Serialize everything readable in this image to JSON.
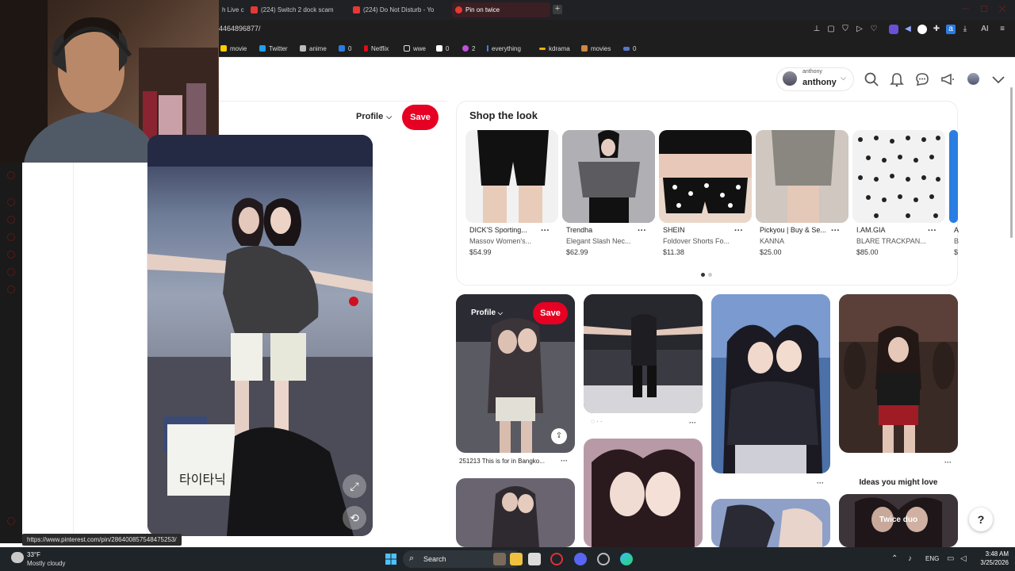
{
  "browser": {
    "tabs": [
      {
        "label": "h Live c"
      },
      {
        "label": "(224) Switch 2 dock scam"
      },
      {
        "label": "(224) Do Not Disturb - Yo"
      },
      {
        "label": "Pin on twice"
      }
    ],
    "new_tab": "+",
    "url": "4464896877/",
    "bookmarks": [
      {
        "label": "movie",
        "color": "#ffcc00"
      },
      {
        "label": "Twitter",
        "color": "#1da1f2"
      },
      {
        "label": "anime",
        "color": "#bbbbbb"
      },
      {
        "label": "0",
        "color": "#2a7de1"
      },
      {
        "label": "Netflix",
        "color": "#e50914"
      },
      {
        "label": "wwe",
        "color": "#dddddd"
      },
      {
        "label": "0",
        "color": "#ffffff"
      },
      {
        "label": "2",
        "color": "#c050e0"
      },
      {
        "label": "everything",
        "color": "#3b82f6"
      },
      {
        "label": "kdrama",
        "color": "#f0b000"
      },
      {
        "label": "movies",
        "color": "#cc8844"
      },
      {
        "label": "0",
        "color": "#5577cc"
      }
    ],
    "toolbar_text": "AI"
  },
  "header": {
    "user_small": "anthony",
    "user_name": "anthony",
    "chevron": "⌵"
  },
  "pin_detail": {
    "profile_label": "Profile",
    "save_label": "Save"
  },
  "shop": {
    "title": "Shop the look",
    "products": [
      {
        "brand": "DICK'S Sporting...",
        "name": "Massov Women's...",
        "price": "$54.99",
        "more": "···"
      },
      {
        "brand": "Trendha",
        "name": "Elegant Slash Nec...",
        "price": "$62.99",
        "more": "···"
      },
      {
        "brand": "SHEIN",
        "name": "Foldover Shorts Fo...",
        "price": "$11.38",
        "more": "···"
      },
      {
        "brand": "Pickyou | Buy & Se...",
        "name": "KANNA",
        "price": "$25.00",
        "more": "···"
      },
      {
        "brand": "I.AM.GIA",
        "name": "BLARE TRACKPAN...",
        "price": "$85.00",
        "more": "···"
      },
      {
        "brand": "A",
        "name": "B",
        "price": "$",
        "more": ""
      }
    ]
  },
  "grid": {
    "pin1_profile": "Profile",
    "pin1_save": "Save",
    "pin1_caption": "251213 This is for in Bangko...",
    "more": "···",
    "ideas_title": "Ideas you might love",
    "twice_duo": "Twice duo"
  },
  "status_url": "https://www.pinterest.com/pin/286400857548475253/",
  "taskbar": {
    "weather_temp": "33°F",
    "weather_desc": "Mostly cloudy",
    "search_label": "Search",
    "lang": "ENG",
    "time": "3:48 AM",
    "date": "3/25/2026"
  },
  "colors": {
    "pinterest_red": "#e60023",
    "chrome_dark": "#202124",
    "taskbar": "#1f2428"
  }
}
